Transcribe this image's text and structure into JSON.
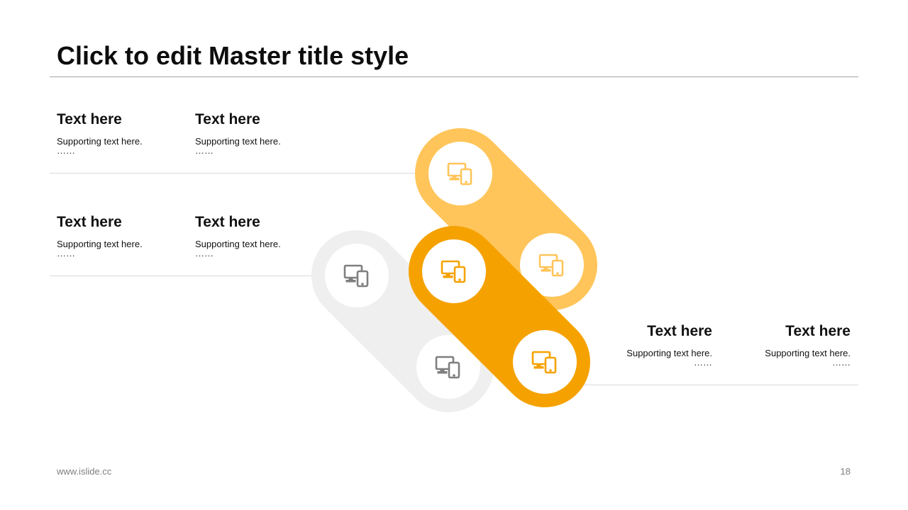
{
  "title": "Click to edit Master title style",
  "blocks": [
    {
      "heading": "Text here",
      "sub": "Supporting  text here.",
      "dots": "……"
    },
    {
      "heading": "Text here",
      "sub": "Supporting  text here.",
      "dots": "……"
    },
    {
      "heading": "Text here",
      "sub": "Supporting  text here.",
      "dots": "……"
    },
    {
      "heading": "Text here",
      "sub": "Supporting  text here.",
      "dots": "……"
    },
    {
      "heading": "Text here",
      "sub": "Supporting  text here.",
      "dots": "……"
    },
    {
      "heading": "Text here",
      "sub": "Supporting  text here.",
      "dots": "……"
    }
  ],
  "colors": {
    "light_orange": "#ffc55a",
    "orange": "#f5a200",
    "gray_ring": "#efefef",
    "icon_gray": "#7f7f7f"
  },
  "icons": [
    "devices-icon",
    "devices-icon",
    "devices-icon",
    "devices-icon",
    "devices-icon",
    "devices-icon"
  ],
  "footer": {
    "website": "www.islide.cc",
    "page_number": "18"
  }
}
